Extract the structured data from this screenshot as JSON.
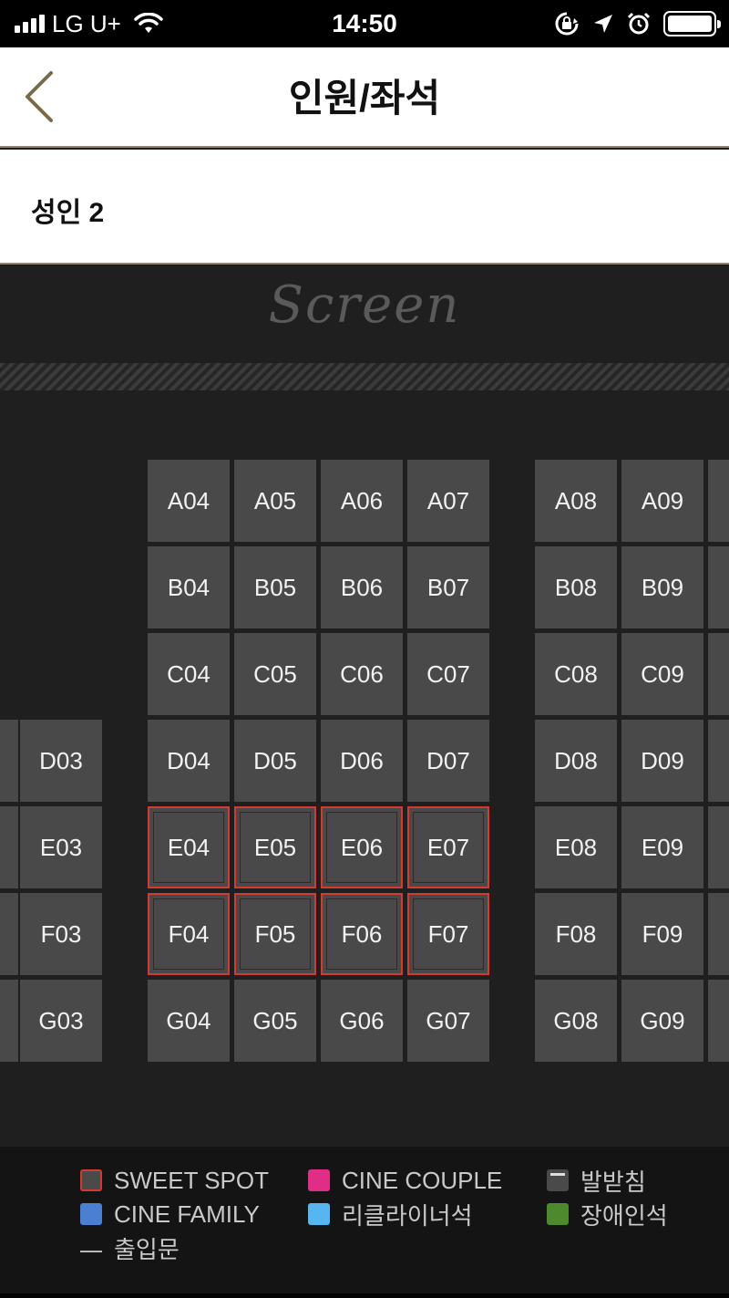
{
  "status_bar": {
    "carrier": "LG U+",
    "time": "14:50",
    "icons": [
      "signal-icon",
      "wifi-icon",
      "rotation-lock-icon",
      "location-arrow-icon",
      "alarm-icon",
      "battery-icon"
    ]
  },
  "header": {
    "title": "인원/좌석",
    "back_icon": "chevron-left-icon"
  },
  "people": {
    "label": "성인 2"
  },
  "screen": {
    "label": "Screen"
  },
  "seats": [
    {
      "id": "A04",
      "sweet": false
    },
    {
      "id": "A05",
      "sweet": false
    },
    {
      "id": "A06",
      "sweet": false
    },
    {
      "id": "A07",
      "sweet": false
    },
    {
      "id": "A08",
      "sweet": false
    },
    {
      "id": "A09",
      "sweet": false
    },
    {
      "id": "B04",
      "sweet": false
    },
    {
      "id": "B05",
      "sweet": false
    },
    {
      "id": "B06",
      "sweet": false
    },
    {
      "id": "B07",
      "sweet": false
    },
    {
      "id": "B08",
      "sweet": false
    },
    {
      "id": "B09",
      "sweet": false
    },
    {
      "id": "C04",
      "sweet": false
    },
    {
      "id": "C05",
      "sweet": false
    },
    {
      "id": "C06",
      "sweet": false
    },
    {
      "id": "C07",
      "sweet": false
    },
    {
      "id": "C08",
      "sweet": false
    },
    {
      "id": "C09",
      "sweet": false
    },
    {
      "id": "D03",
      "sweet": false
    },
    {
      "id": "D04",
      "sweet": false
    },
    {
      "id": "D05",
      "sweet": false
    },
    {
      "id": "D06",
      "sweet": false
    },
    {
      "id": "D07",
      "sweet": false
    },
    {
      "id": "D08",
      "sweet": false
    },
    {
      "id": "D09",
      "sweet": false
    },
    {
      "id": "E03",
      "sweet": false
    },
    {
      "id": "E04",
      "sweet": true
    },
    {
      "id": "E05",
      "sweet": true
    },
    {
      "id": "E06",
      "sweet": true
    },
    {
      "id": "E07",
      "sweet": true
    },
    {
      "id": "E08",
      "sweet": false
    },
    {
      "id": "E09",
      "sweet": false
    },
    {
      "id": "F03",
      "sweet": false
    },
    {
      "id": "F04",
      "sweet": true
    },
    {
      "id": "F05",
      "sweet": true
    },
    {
      "id": "F06",
      "sweet": true
    },
    {
      "id": "F07",
      "sweet": true
    },
    {
      "id": "F08",
      "sweet": false
    },
    {
      "id": "F09",
      "sweet": false
    },
    {
      "id": "G03",
      "sweet": false
    },
    {
      "id": "G04",
      "sweet": false
    },
    {
      "id": "G05",
      "sweet": false
    },
    {
      "id": "G06",
      "sweet": false
    },
    {
      "id": "G07",
      "sweet": false
    },
    {
      "id": "G08",
      "sweet": false
    },
    {
      "id": "G09",
      "sweet": false
    }
  ],
  "legend": {
    "sweet_spot": "SWEET SPOT",
    "cine_couple": "CINE COUPLE",
    "footrest": "발받침",
    "cine_family": "CINE FAMILY",
    "recliner": "리클라이너석",
    "disabled": "장애인석",
    "exit": "출입문"
  },
  "colors": {
    "sweet_spot": "#d23a32",
    "cine_couple": "#e02d86",
    "cine_family": "#4a7fd1",
    "recliner": "#55b6f0",
    "disabled": "#4c8a2d",
    "seat": "#494949"
  }
}
